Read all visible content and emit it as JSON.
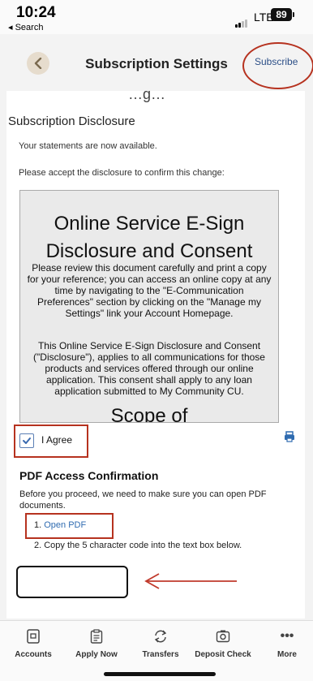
{
  "status_bar": {
    "time": "10:24",
    "back_app": "◂ Search",
    "network": "LTE",
    "battery": "89"
  },
  "header": {
    "title": "Subscription Settings",
    "subscribe_label": "Subscribe",
    "scroll_fragment": "…ɡ…"
  },
  "disclosure": {
    "heading": "Subscription Disclosure",
    "statements_text": "Your statements are now available.",
    "accept_text": "Please accept the disclosure to confirm this change:",
    "doc_title_line1": "Online Service E-Sign",
    "doc_title_line2": "Disclosure and Consent",
    "doc_paragraph_1": "Please review this document carefully and print a copy for your reference; you can access an online copy at any time by  navigating to the \"E-Communication Preferences\" section by clicking on the \"Manage my Settings\" link your Account   Homepage.",
    "doc_paragraph_2": "This Online Service E-Sign Disclosure and Consent (\"Disclosure\"), applies to all communications for those products and services offered through our online application. This consent shall apply to any loan application submitted to My Community  CU.",
    "doc_next_heading": "Scope of"
  },
  "agree": {
    "label": "I Agree",
    "checked": true
  },
  "pdf": {
    "heading": "PDF Access Confirmation",
    "description": "Before you proceed, we need to make sure you can open PDF documents.",
    "step1_number": "1.",
    "step1_link": "Open PDF",
    "step2_text": "2.  Copy the 5 character code into the text box below.",
    "code_value": ""
  },
  "tabs": [
    {
      "label": "Accounts",
      "icon": "accounts-icon"
    },
    {
      "label": "Apply Now",
      "icon": "clipboard-icon"
    },
    {
      "label": "Transfers",
      "icon": "transfer-icon"
    },
    {
      "label": "Deposit Check",
      "icon": "camera-icon"
    },
    {
      "label": "More",
      "icon": "more-icon"
    }
  ],
  "colors": {
    "accent": "#2f6bb0",
    "annotation_red": "#b6321f"
  }
}
